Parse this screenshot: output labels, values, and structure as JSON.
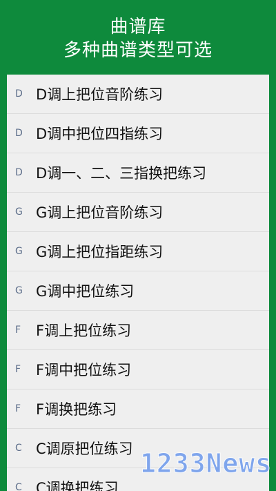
{
  "header": {
    "title": "曲谱库",
    "subtitle": "多种曲谱类型可选"
  },
  "list": {
    "items": [
      {
        "key": "D",
        "name": "D调上把位音阶练习"
      },
      {
        "key": "D",
        "name": "D调中把位四指练习"
      },
      {
        "key": "D",
        "name": "D调一、二、三指换把练习"
      },
      {
        "key": "G",
        "name": "G调上把位音阶练习"
      },
      {
        "key": "G",
        "name": "G调上把位指距练习"
      },
      {
        "key": "G",
        "name": "G调中把位练习"
      },
      {
        "key": "F",
        "name": "F调上把位练习"
      },
      {
        "key": "F",
        "name": "F调中把位练习"
      },
      {
        "key": "F",
        "name": "F调换把练习"
      },
      {
        "key": "C",
        "name": "C调原把位练习"
      },
      {
        "key": "C",
        "name": "C调换把练习"
      }
    ]
  },
  "watermark": {
    "text": "1233News"
  },
  "colors": {
    "header_bg": "#0e8a3c",
    "list_bg": "#efefef",
    "key_text": "#5d6e8a"
  }
}
